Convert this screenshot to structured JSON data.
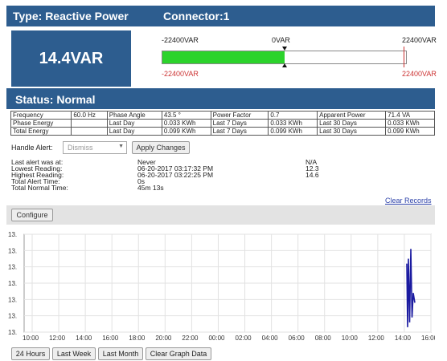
{
  "header": {
    "type_label": "Type: Reactive Power",
    "connector_label": "Connector:1"
  },
  "reading": {
    "value": "14.4VAR"
  },
  "gauge": {
    "min_top": "-22400VAR",
    "mid_top": "0VAR",
    "max_top": "22400VAR",
    "min_bottom": "-22400VAR",
    "max_bottom": "22400VAR",
    "fill_fraction": 0.5,
    "fill_color": "#2bd32b"
  },
  "status": {
    "label": "Status: Normal"
  },
  "info_table": [
    [
      "Frequency",
      "60.0 Hz",
      "Phase Angle",
      "43.5 °",
      "Power Factor",
      "0.7",
      "Apparent Power",
      "71.4 VA"
    ],
    [
      "Phase Energy",
      "",
      "Last Day",
      "0.033 KWh",
      "Last 7 Days",
      "0.033 KWh",
      "Last 30 Days",
      "0.033 KWh"
    ],
    [
      "Total Energy",
      "",
      "Last Day",
      "0.099 KWh",
      "Last 7 Days",
      "0.099 KWh",
      "Last 30 Days",
      "0.099 KWh"
    ]
  ],
  "alert": {
    "handle_label": "Handle Alert:",
    "select_value": "Dismiss",
    "apply_label": "Apply Changes"
  },
  "records": {
    "labels": [
      "Last alert was at:",
      "Lowest Reading:",
      "Highest Reading:",
      "Total Alert Time:",
      "Total Normal Time:"
    ],
    "times": [
      "Never",
      "06-20-2017 03:17:32 PM",
      "06-20-2017 03:22:25 PM",
      "0s",
      "45m 13s"
    ],
    "values": [
      "N/A",
      "12.3",
      "14.6",
      "",
      ""
    ],
    "clear_label": "Clear Records"
  },
  "configure_label": "Configure",
  "chart_data": {
    "type": "line",
    "y_ticks": [
      "13.",
      "13.",
      "13.",
      "13.",
      "13.",
      "13.",
      "13."
    ],
    "x_ticks": [
      "10:00",
      "12:00",
      "14:00",
      "16:00",
      "18:00",
      "20:00",
      "22:00",
      "00:00",
      "02:00",
      "04:00",
      "06:00",
      "08:00",
      "10:00",
      "12:00",
      "14:00",
      "16:00"
    ],
    "grid": true,
    "line_color": "#1a1aa0"
  },
  "graph_buttons": [
    "24 Hours",
    "Last Week",
    "Last Month",
    "Clear Graph Data"
  ]
}
